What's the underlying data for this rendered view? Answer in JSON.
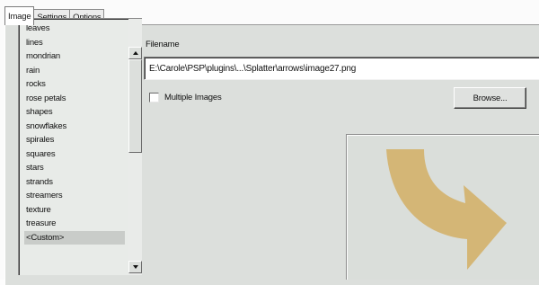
{
  "tabs": [
    {
      "label": "Image",
      "active": true
    },
    {
      "label": "Settings",
      "active": false
    },
    {
      "label": "Options",
      "active": false
    }
  ],
  "list": {
    "items": [
      "leaves",
      "lines",
      "mondrian",
      "rain",
      "rocks",
      "rose petals",
      "shapes",
      "snowflakes",
      "spirales",
      "squares",
      "stars",
      "strands",
      "streamers",
      "texture",
      "treasure",
      "<Custom>"
    ],
    "selected": "<Custom>"
  },
  "filename": {
    "label": "Filename",
    "value": "E:\\Carole\\PSP\\plugins\\...\\Splatter\\arrows\\image27.png"
  },
  "multiple_images": {
    "label": "Multiple Images",
    "checked": false
  },
  "browse_button": {
    "label": "Browse..."
  },
  "preview": {
    "icon": "curved-arrow-icon",
    "arrow_color": "#d4b676",
    "background_color": "#dadeda"
  }
}
